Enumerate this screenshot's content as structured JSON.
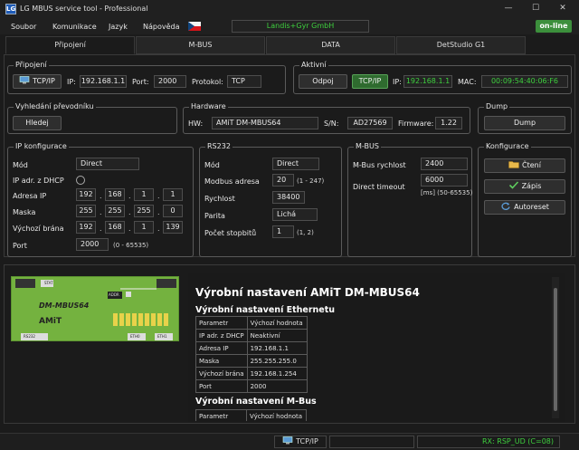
{
  "window": {
    "title": "LG MBUS service tool - Professional",
    "icon_text": "LG",
    "controls": [
      "—",
      "☐",
      "✕"
    ]
  },
  "menu": {
    "items": [
      "Soubor",
      "Komunikace",
      "Jazyk",
      "Nápověda"
    ]
  },
  "header": {
    "company": "Landis+Gyr GmbH",
    "status": "on-line"
  },
  "tabs": [
    "Připojení",
    "M-BUS",
    "DATA",
    "DetStudio G1"
  ],
  "pripojeni": {
    "legend": "Připojení",
    "conn_type": "TCP/IP",
    "ip_label": "IP:",
    "ip": "192.168.1.1",
    "port_label": "Port:",
    "port": "2000",
    "protocol_label": "Protokol:",
    "protocol": "TCP"
  },
  "aktivni": {
    "legend": "Aktivní",
    "disconnect": "Odpoj",
    "conn_type": "TCP/IP",
    "ip_label": "IP:",
    "ip": "192.168.1.1",
    "mac_label": "MAC:",
    "mac": "00:09:54:40:06:F6"
  },
  "vyhledani": {
    "legend": "Vyhledání převodníku",
    "button": "Hledej"
  },
  "hardware": {
    "legend": "Hardware",
    "hw_label": "HW:",
    "hw": "AMiT DM-MBUS64",
    "sn_label": "S/N:",
    "sn": "AD27569",
    "fw_label": "Firmware:",
    "fw": "1.22"
  },
  "dump": {
    "legend": "Dump",
    "button": "Dump"
  },
  "ip_config": {
    "legend": "IP konfigurace",
    "mode_label": "Mód",
    "mode": "Direct",
    "dhcp_label": "IP adr. z DHCP",
    "ip_label": "Adresa IP",
    "ip": [
      "192",
      "168",
      "1",
      "1"
    ],
    "mask_label": "Maska",
    "mask": [
      "255",
      "255",
      "255",
      "0"
    ],
    "gw_label": "Výchozí brána",
    "gw": [
      "192",
      "168",
      "1",
      "139"
    ],
    "port_label": "Port",
    "port": "2000",
    "port_range": "(0 - 65535)"
  },
  "rs232": {
    "legend": "RS232",
    "mode_label": "Mód",
    "mode": "Direct",
    "modbus_label": "Modbus adresa",
    "modbus": "20",
    "modbus_range": "(1 - 247)",
    "speed_label": "Rychlost",
    "speed": "38400",
    "parity_label": "Parita",
    "parity": "Lichá",
    "stopbits_label": "Počet stopbitů",
    "stopbits": "1",
    "stopbits_range": "(1, 2)"
  },
  "mbus": {
    "legend": "M-BUS",
    "speed_label": "M-Bus rychlost",
    "speed": "2400",
    "timeout_label": "Direct timeout",
    "timeout": "6000",
    "timeout_range": "[ms] (50-65535)"
  },
  "konfigurace": {
    "legend": "Konfigurace",
    "read": "Čtení",
    "write": "Zápis",
    "autoreset": "Autoreset"
  },
  "board": {
    "name": "DM-MBUS64",
    "brand": "AMiT",
    "labels": [
      "ADDR",
      "RS232",
      "ETH0",
      "ETH1",
      "STAT"
    ]
  },
  "doc": {
    "title": "Výrobní nastavení AMiT DM-MBUS64",
    "section1": "Výrobní nastavení Ethernetu",
    "headers": [
      "Parametr",
      "Výchozí hodnota"
    ],
    "rows": [
      [
        "IP adr. z DHCP",
        "Neaktivní"
      ],
      [
        "Adresa IP",
        "192.168.1.1"
      ],
      [
        "Maska",
        "255.255.255.0"
      ],
      [
        "Výchozí brána",
        "192.168.1.254"
      ],
      [
        "Port",
        "2000"
      ]
    ],
    "section2": "Výrobní nastavení M-Bus",
    "headers2": [
      "Parametr",
      "Výchozí hodnota"
    ]
  },
  "statusbar": {
    "conn": "TCP/IP",
    "rx": "RX: RSP_UD (C=08)"
  },
  "colors": {
    "accent_green": "#3ecf3e",
    "online_bg": "#3c8f3c",
    "panel_bg": "#1b1b1b"
  }
}
